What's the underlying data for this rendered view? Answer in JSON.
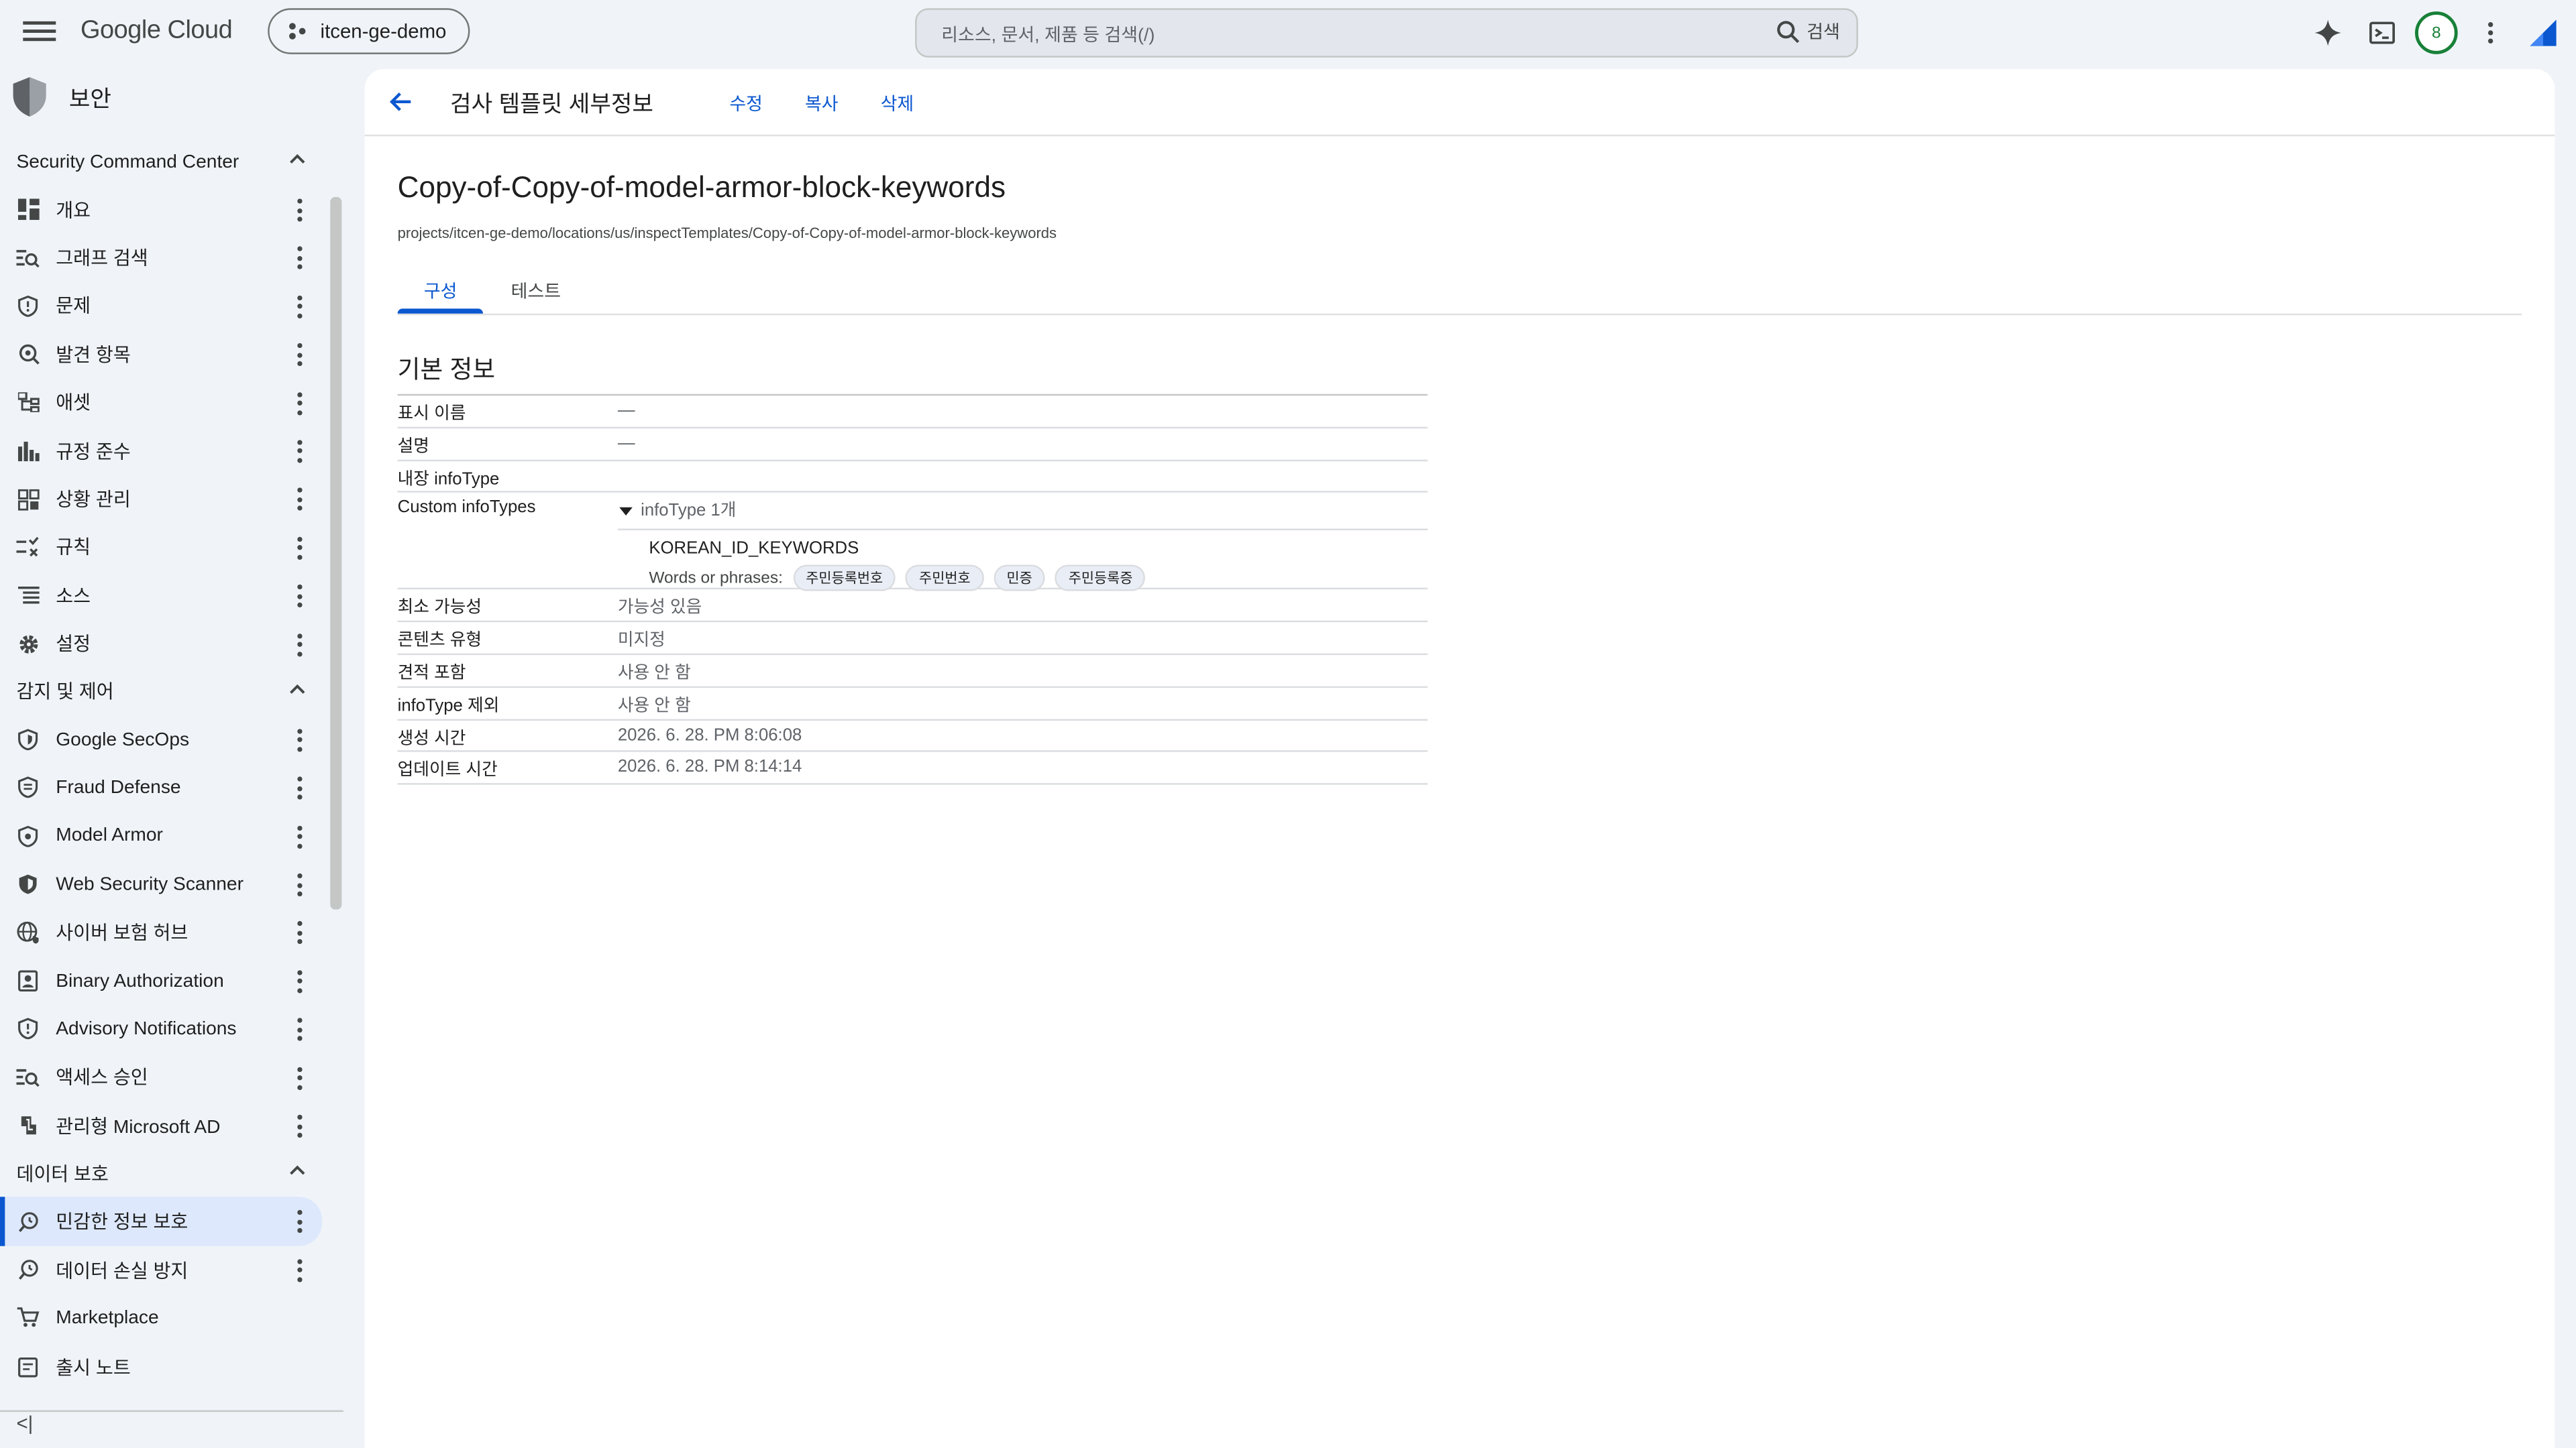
{
  "topbar": {
    "brand": "Google Cloud",
    "project": "itcen-ge-demo",
    "search_placeholder": "리소스, 문서, 제품 등 검색(/)",
    "search_button": "검색",
    "avatar": "8",
    "icons": [
      "menu-icon",
      "sparkle-icon",
      "terminal-icon",
      "more-vert-icon",
      "gemini-logo"
    ]
  },
  "sidebar": {
    "title": "보안",
    "sections": [
      {
        "label": "Security Command Center",
        "items": [
          "개요",
          "그래프 검색",
          "문제",
          "발견 항목",
          "애셋",
          "규정 준수",
          "상황 관리",
          "규칙",
          "소스",
          "설정"
        ]
      },
      {
        "label": "감지 및 제어",
        "items": [
          "Google SecOps",
          "Fraud Defense",
          "Model Armor",
          "Web Security Scanner",
          "사이버 보험 허브",
          "Binary Authorization",
          "Advisory Notifications",
          "액세스 승인",
          "관리형 Microsoft AD"
        ]
      },
      {
        "label": "데이터 보호",
        "items": [
          "민감한 정보 보호",
          "데이터 손실 방지",
          "Marketplace"
        ]
      }
    ],
    "active_item": "민감한 정보 보호",
    "release_notes": "출시 노트",
    "collapse": "<|"
  },
  "header": {
    "title": "검사 템플릿 세부정보",
    "actions": [
      "수정",
      "복사",
      "삭제"
    ]
  },
  "template": {
    "name": "Copy-of-Copy-of-model-armor-block-keywords",
    "path": "projects/itcen-ge-demo/locations/us/inspectTemplates/Copy-of-Copy-of-model-armor-block-keywords"
  },
  "tabs": [
    "구성",
    "테스트"
  ],
  "active_tab": "구성",
  "basic_info": {
    "heading": "기본 정보",
    "rows": [
      {
        "k": "표시 이름",
        "v": "—"
      },
      {
        "k": "설명",
        "v": "—"
      },
      {
        "k": "내장 infoType",
        "v": ""
      }
    ],
    "custom": {
      "k": "Custom infoTypes",
      "toggle": "infoType 1개",
      "name": "KOREAN_ID_KEYWORDS",
      "words_label": "Words or phrases:",
      "words": [
        "주민등록번호",
        "주민번호",
        "민증",
        "주민등록증"
      ]
    },
    "rows2": [
      {
        "k": "최소 가능성",
        "v": "가능성 있음"
      },
      {
        "k": "콘텐츠 유형",
        "v": "미지정"
      },
      {
        "k": "견적 포함",
        "v": "사용 안 함"
      },
      {
        "k": "infoType 제외",
        "v": "사용 안 함"
      },
      {
        "k": "생성 시간",
        "v": "2026. 6. 28. PM 8:06:08"
      },
      {
        "k": "업데이트 시간",
        "v": "2026. 6. 28. PM 8:14:14"
      }
    ]
  },
  "colors": {
    "accent": "#0b57d0",
    "bg": "#f0f4f9",
    "active_bg": "#dde8fc",
    "avatar": "#188038"
  }
}
